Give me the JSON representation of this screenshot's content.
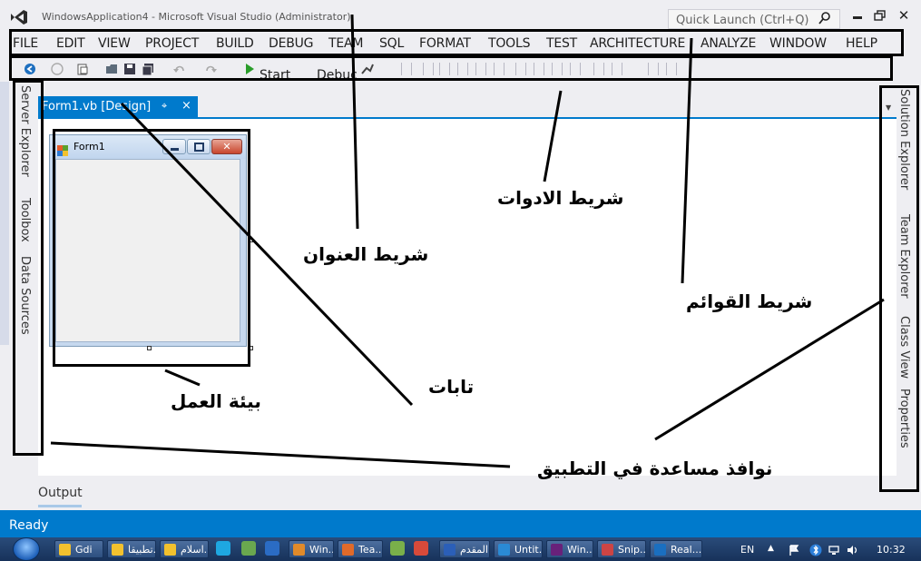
{
  "window": {
    "title": "WindowsApplication4 - Microsoft Visual Studio (Administrator)",
    "quick_launch_placeholder": "Quick Launch (Ctrl+Q)"
  },
  "menu": [
    "FILE",
    "EDIT",
    "VIEW",
    "PROJECT",
    "BUILD",
    "DEBUG",
    "TEAM",
    "SQL",
    "FORMAT",
    "TOOLS",
    "TEST",
    "ARCHITECTURE",
    "ANALYZE",
    "WINDOW",
    "HELP"
  ],
  "toolbar": {
    "start_label": "Start",
    "config_label": "Debuc"
  },
  "left_tabs": [
    "Server Explorer",
    "Toolbox",
    "Data Sources"
  ],
  "right_tabs": [
    "Solution Explorer",
    "Team Explorer",
    "Class View",
    "Properties"
  ],
  "document_tab": {
    "label": "Form1.vb [Design]",
    "pin": "⌖",
    "close": "×"
  },
  "form": {
    "title": "Form1"
  },
  "output_tab": "Output",
  "status": "Ready",
  "taskbar": {
    "items": [
      "Gdi",
      "تطبيقا..",
      "اسلام..",
      "Win...",
      "Tea...",
      "المقدم..",
      "Untit...",
      "Win...",
      "Snip...",
      "Real..."
    ],
    "language": "EN",
    "clock": "10:32"
  },
  "annotations": {
    "title_bar": "شريط العنوان",
    "toolbar": "شريط الادوات",
    "menu_bar": "شريط القوائم",
    "tabs": "تابات",
    "workspace": "بيئة العمل",
    "helper_windows": "نوافذ مساعدة في التطبيق"
  },
  "colors": {
    "accent": "#007acc",
    "chrome": "#eeeef2"
  }
}
